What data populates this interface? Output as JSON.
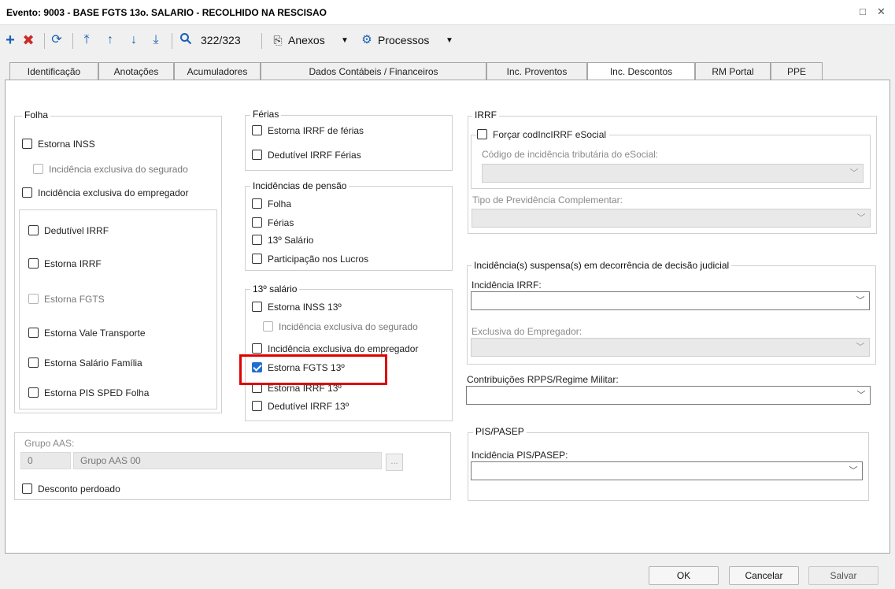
{
  "window": {
    "title": "Evento: 9003 - BASE FGTS 13o. SALARIO - RECOLHIDO NA RESCISAO",
    "maximize_glyph": "□",
    "close_glyph": "✕"
  },
  "toolbar": {
    "record_counter": "322/323",
    "attachments_label": "Anexos",
    "processes_label": "Processos",
    "icons": [
      "add-icon",
      "delete-icon",
      "refresh-icon",
      "first-icon",
      "previous-icon",
      "next-icon",
      "last-icon",
      "search-icon",
      "attachment-icon",
      "gear-icon"
    ]
  },
  "tabs": [
    {
      "label": "Identificação"
    },
    {
      "label": "Anotações"
    },
    {
      "label": "Acumuladores"
    },
    {
      "label": "Dados Contábeis / Financeiros"
    },
    {
      "label": "Inc. Proventos"
    },
    {
      "label": "Inc. Descontos",
      "active": true
    },
    {
      "label": "RM Portal"
    },
    {
      "label": "PPE"
    }
  ],
  "folha": {
    "title": "Folha",
    "estorna_inss": "Estorna INSS",
    "inc_excl_segurado": "Incidência exclusiva do segurado",
    "inc_excl_empregador": "Incidência exclusiva do empregador",
    "dedutivel_irrf": "Dedutível IRRF",
    "estorna_irrf": "Estorna IRRF",
    "estorna_fgts": "Estorna FGTS",
    "estorna_vale_transporte": "Estorna Vale Transporte",
    "estorna_salario_familia": "Estorna Salário Família",
    "estorna_pis_sped": "Estorna PIS SPED Folha"
  },
  "grupo_aas": {
    "label": "Grupo AAS:",
    "code": "0",
    "name": "Grupo AAS 00",
    "browse_label": "...",
    "desconto_perdoado": "Desconto perdoado"
  },
  "ferias": {
    "title": "Férias",
    "estorna_irrf_ferias": "Estorna IRRF de férias",
    "dedutivel_irrf_ferias": "Dedutível IRRF Férias"
  },
  "pensao": {
    "title": "Incidências de pensão",
    "folha": "Folha",
    "ferias": "Férias",
    "decimo": "13º Salário",
    "plr": "Participação nos Lucros"
  },
  "decimo": {
    "title": "13º salário",
    "estorna_inss": "Estorna INSS 13º",
    "inc_excl_segurado": "Incidência exclusiva do segurado",
    "inc_excl_empregador": "Incidência exclusiva do empregador",
    "estorna_fgts": "Estorna FGTS 13º",
    "estorna_irrf": "Estorna IRRF 13º",
    "dedutivel_irrf": "Dedutível IRRF 13º"
  },
  "irrf": {
    "title": "IRRF",
    "forcar": "Forçar codIncIRRF eSocial",
    "codigo_label": "Código de incidência tributária do eSocial:",
    "tipo_prev_label": "Tipo de Previdência Complementar:"
  },
  "suspensas": {
    "title": "Incidência(s) suspensa(s) em decorrência de decisão judicial",
    "irrf_label": "Incidência IRRF:",
    "excl_empregador_label": "Exclusiva do Empregador:"
  },
  "rpps": {
    "label": "Contribuições RPPS/Regime Militar:"
  },
  "pis": {
    "title": "PIS/PASEP",
    "label": "Incidência PIS/PASEP:"
  },
  "footer": {
    "ok": "OK",
    "cancel": "Cancelar",
    "save": "Salvar"
  },
  "colors": {
    "accent": "#1f6fd0",
    "highlight": "#e00000",
    "toolbar_icon": "#1a5fb4",
    "delete_icon": "#cc2a2a"
  }
}
